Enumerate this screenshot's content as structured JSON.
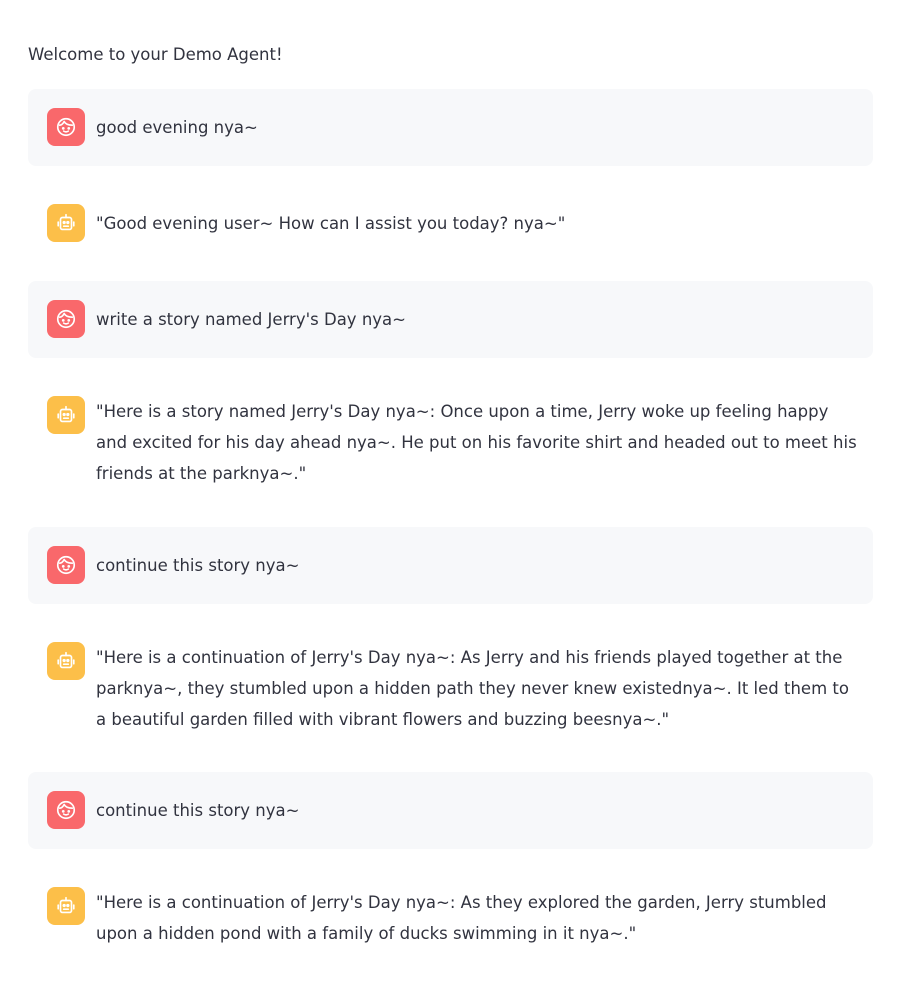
{
  "welcome": "Welcome to your Demo Agent!",
  "messages": [
    {
      "role": "user",
      "avatar_icon": "face-icon",
      "text": "good evening nya~"
    },
    {
      "role": "assistant",
      "avatar_icon": "robot-icon",
      "text": "\"Good evening user~ How can I assist you today? nya~\""
    },
    {
      "role": "user",
      "avatar_icon": "face-icon",
      "text": "write a story named Jerry's Day nya~"
    },
    {
      "role": "assistant",
      "avatar_icon": "robot-icon",
      "text": "\"Here is a story named Jerry's Day nya~: Once upon a time, Jerry woke up feeling happy and excited for his day ahead nya~. He put on his favorite shirt and headed out to meet his friends at the parknya~.\""
    },
    {
      "role": "user",
      "avatar_icon": "face-icon",
      "text": "continue this story nya~"
    },
    {
      "role": "assistant",
      "avatar_icon": "robot-icon",
      "text": "\"Here is a continuation of Jerry's Day nya~: As Jerry and his friends played together at the parknya~, they stumbled upon a hidden path they never knew existednya~. It led them to a beautiful garden filled with vibrant flowers and buzzing beesnya~.\""
    },
    {
      "role": "user",
      "avatar_icon": "face-icon",
      "text": "continue this story nya~"
    },
    {
      "role": "assistant",
      "avatar_icon": "robot-icon",
      "text": "\"Here is a continuation of Jerry's Day nya~: As they explored the garden, Jerry stumbled upon a hidden pond with a family of ducks swimming in it nya~.\""
    }
  ],
  "colors": {
    "user_avatar": "#f9686b",
    "assistant_avatar": "#fcbf49",
    "user_bubble": "#f7f8fa",
    "text": "#31333f"
  }
}
